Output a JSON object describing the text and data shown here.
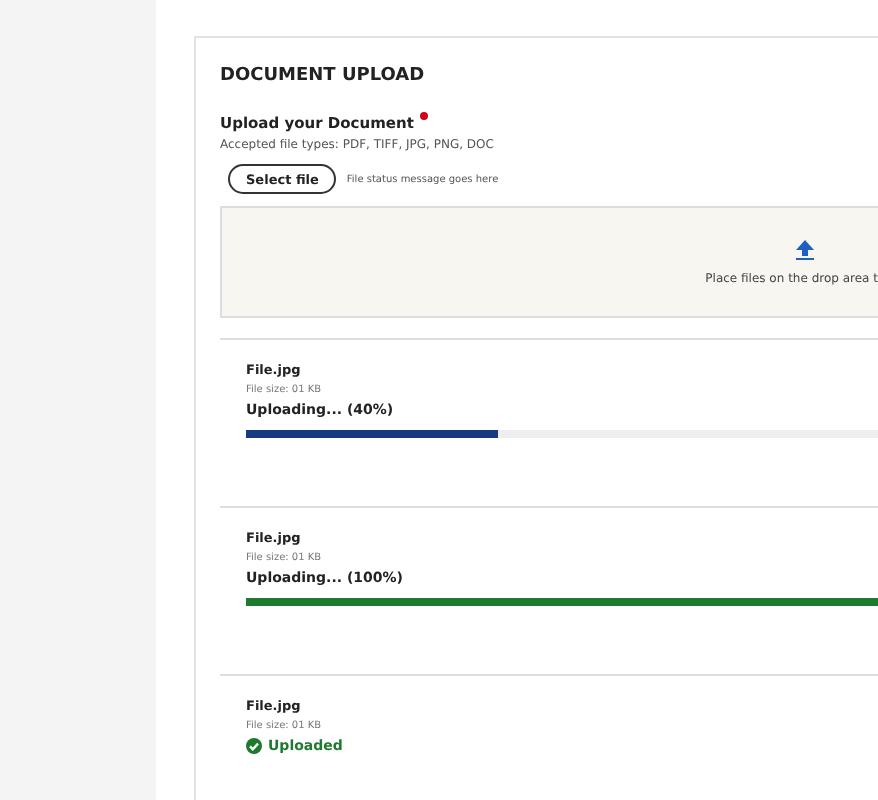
{
  "title": "DOCUMENT UPLOAD",
  "field": {
    "label": "Upload your Document",
    "required": true,
    "hint": "Accepted file types: PDF, TIFF, JPG, PNG, DOC",
    "button": "Select file",
    "status": "File status message goes here"
  },
  "drop_area": {
    "text": "Place files on the drop area t"
  },
  "files": [
    {
      "kind": "progress",
      "name": "File.jpg",
      "size": "File size: 01 KB",
      "status": "Uploading... (40%)",
      "level": 0.4
    },
    {
      "kind": "progress",
      "name": "File.jpg",
      "size": "File size: 01 KB",
      "status": "Uploading... (100%)",
      "level": 1
    },
    {
      "kind": "done",
      "name": "File.jpg",
      "size": "File size: 01 KB",
      "status": "Uploaded"
    }
  ]
}
